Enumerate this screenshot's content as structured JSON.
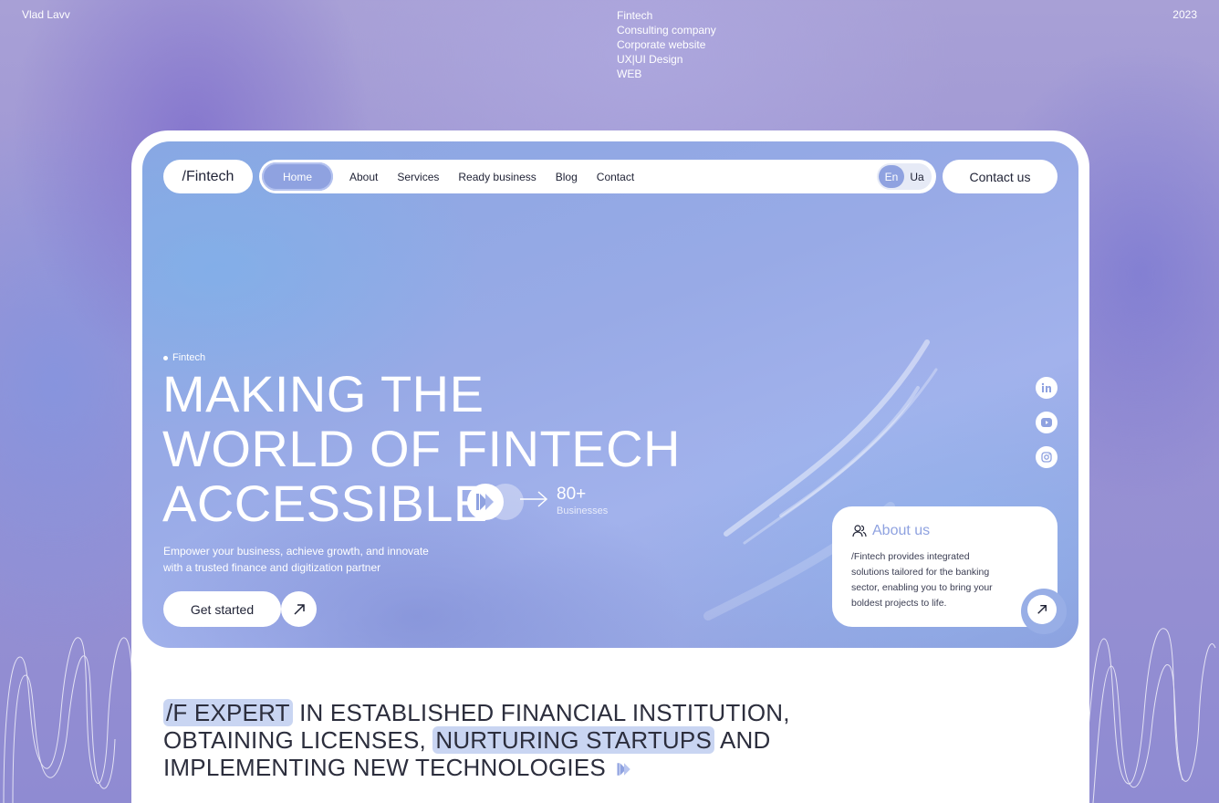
{
  "meta": {
    "author": "Vlad Lavv",
    "tags": [
      "Fintech",
      "Consulting company",
      "Corporate website",
      "UX|UI Design",
      "WEB"
    ],
    "year": "2023"
  },
  "nav": {
    "logo": "/Fintech",
    "items": [
      {
        "label": "Home",
        "active": true
      },
      {
        "label": "About"
      },
      {
        "label": "Services"
      },
      {
        "label": "Ready business"
      },
      {
        "label": "Blog"
      },
      {
        "label": "Contact"
      }
    ],
    "languages": [
      {
        "label": "En",
        "active": true
      },
      {
        "label": "Ua"
      }
    ],
    "contact_button": "Contact us"
  },
  "hero": {
    "eyebrow": "Fintech",
    "headline": [
      "MAKING THE",
      "WORLD OF FINTECH",
      "ACCESSIBLE"
    ],
    "stat_value": "80+",
    "stat_label": "Businesses",
    "subtext": "Empower your business, achieve growth, and innovate with a trusted finance and digitization partner",
    "cta_label": "Get started",
    "socials": [
      "linkedin-icon",
      "youtube-icon",
      "instagram-icon"
    ]
  },
  "about": {
    "title": "About us",
    "text": "/Fintech provides integrated solutions tailored for the banking sector, enabling you to bring your boldest projects to life."
  },
  "tagline": {
    "hl1": "/F EXPERT",
    "t1": " IN ESTABLISHED FINANCIAL INSTITUTION,",
    "t2": "OBTAINING LICENSES, ",
    "hl2": "NURTURING STARTUPS",
    "t3": " AND",
    "t4": "IMPLEMENTING NEW TECHNOLOGIES"
  },
  "colors": {
    "accent": "#8fa2e0",
    "text_dark": "#1f2235",
    "highlight": "#c9d5f2"
  }
}
